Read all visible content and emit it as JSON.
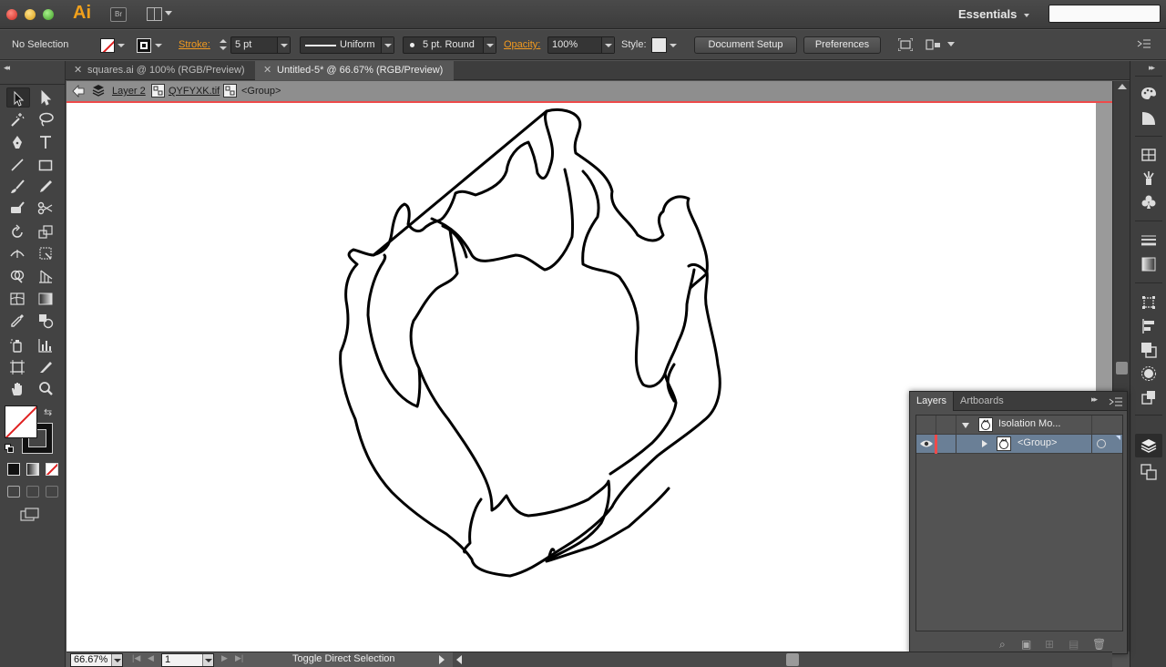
{
  "app": {
    "logo": "Ai",
    "bridge_label": "Br",
    "workspace": "Essentials",
    "search_placeholder": ""
  },
  "control_bar": {
    "selection_label": "No Selection",
    "stroke_label": "Stroke:",
    "stroke_value": "5 pt",
    "profile_label": "Uniform",
    "brush_label": "5 pt. Round",
    "opacity_label": "Opacity:",
    "opacity_value": "100%",
    "style_label": "Style:",
    "document_setup": "Document Setup",
    "preferences": "Preferences"
  },
  "tabs": [
    {
      "label": "squares.ai @ 100% (RGB/Preview)",
      "active": false
    },
    {
      "label": "Untitled-5* @ 66.67% (RGB/Preview)",
      "active": true
    }
  ],
  "breadcrumb": {
    "layer": "Layer 2",
    "image": "QYFYXK.tif",
    "group": "<Group>"
  },
  "layers_panel": {
    "tabs": [
      "Layers",
      "Artboards"
    ],
    "rows": [
      {
        "name": "Isolation Mo...",
        "indent": 1,
        "expanded": true,
        "selected": false
      },
      {
        "name": "<Group>",
        "indent": 2,
        "expanded": false,
        "selected": true
      }
    ]
  },
  "status_bar": {
    "zoom": "66.67%",
    "artboard": "1",
    "status": "Toggle Direct Selection"
  },
  "colors": {
    "accent_orange": "#f29a1f",
    "isolation_line": "#ee4a4a",
    "selected_row": "#6a7f96"
  }
}
